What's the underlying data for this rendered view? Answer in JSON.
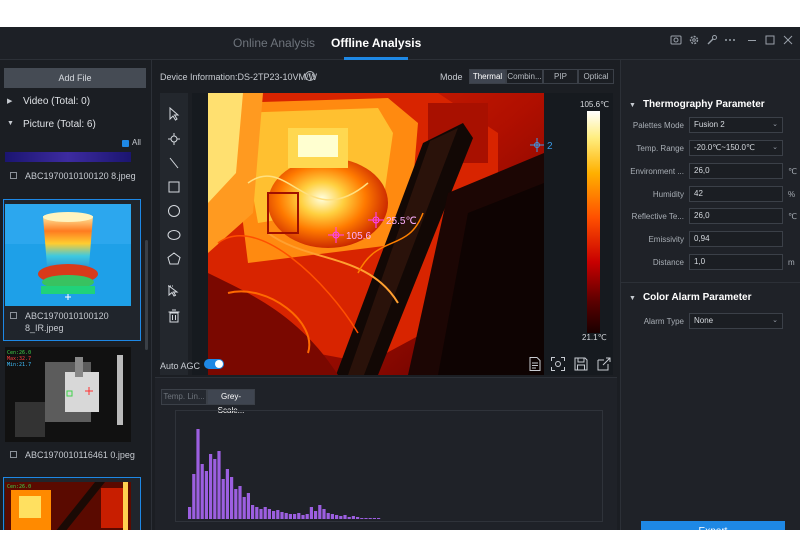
{
  "titlebar": {
    "tabs": [
      {
        "label": "Online Analysis",
        "active": false
      },
      {
        "label": "Offline Analysis",
        "active": true
      }
    ],
    "accent_color": "#1e88e5"
  },
  "left_panel": {
    "add_file_label": "Add File",
    "video_label": "Video (Total: 0)",
    "picture_label": "Picture (Total: 6)",
    "all_label": "All",
    "files": [
      {
        "name": "ABC1970010100120 8.jpeg"
      },
      {
        "name": "ABC1970010100120 8_IR.jpeg"
      },
      {
        "name": "ABC1970010116461 0.jpeg"
      }
    ],
    "thumb_overlay": {
      "l1": "Cen:26.0",
      "l2": "Max:32.7",
      "l3": "Min:21.7"
    }
  },
  "device": {
    "info": "Device Information:DS-2TP23-10VM/W",
    "info_icon": "i",
    "mode_label": "Mode",
    "modes": [
      {
        "label": "Thermal",
        "active": true
      },
      {
        "label": "Combin...",
        "active": false
      },
      {
        "label": "PIP",
        "active": false
      },
      {
        "label": "Optical",
        "active": false
      }
    ]
  },
  "image": {
    "temp_high": "105.6℃",
    "temp_low": "21.1℃",
    "marker_1": "25.5℃",
    "marker_2": "105.6",
    "marker_3": "2",
    "palette_colors": [
      "#ffffff",
      "#ffee80",
      "#ffb000",
      "#ff5000",
      "#c80000",
      "#5a0000",
      "#1a0000"
    ]
  },
  "agc": {
    "label": "Auto AGC",
    "enabled": true
  },
  "histogram": {
    "tabs": [
      {
        "label": "Temp. Lin...",
        "active": false
      },
      {
        "label": "Grey-Scale...",
        "active": true
      }
    ],
    "bar_color": "#9c5fe0",
    "values": [
      4,
      6,
      8,
      5,
      1,
      0,
      0,
      0,
      0,
      0,
      0,
      0,
      0,
      0,
      0,
      0,
      0,
      0,
      0,
      0
    ]
  },
  "right_panel": {
    "thermo_title": "Thermography Parameter",
    "params": [
      {
        "label": "Palettes Mode",
        "value": "Fusion 2",
        "unit": "",
        "dropdown": true
      },
      {
        "label": "Temp. Range",
        "value": "-20.0℃~150.0℃",
        "unit": "",
        "dropdown": true
      },
      {
        "label": "Environment ...",
        "value": "26,0",
        "unit": "℃",
        "dropdown": false
      },
      {
        "label": "Humidity",
        "value": "42",
        "unit": "%",
        "dropdown": false
      },
      {
        "label": "Reflective Te...",
        "value": "26,0",
        "unit": "℃",
        "dropdown": false
      },
      {
        "label": "Emissivity",
        "value": "0,94",
        "unit": "",
        "dropdown": false
      },
      {
        "label": "Distance",
        "value": "1,0",
        "unit": "m",
        "dropdown": false
      }
    ],
    "alarm_title": "Color Alarm Parameter",
    "alarm_type_label": "Alarm Type",
    "alarm_type_value": "None",
    "export_label": "Export"
  }
}
